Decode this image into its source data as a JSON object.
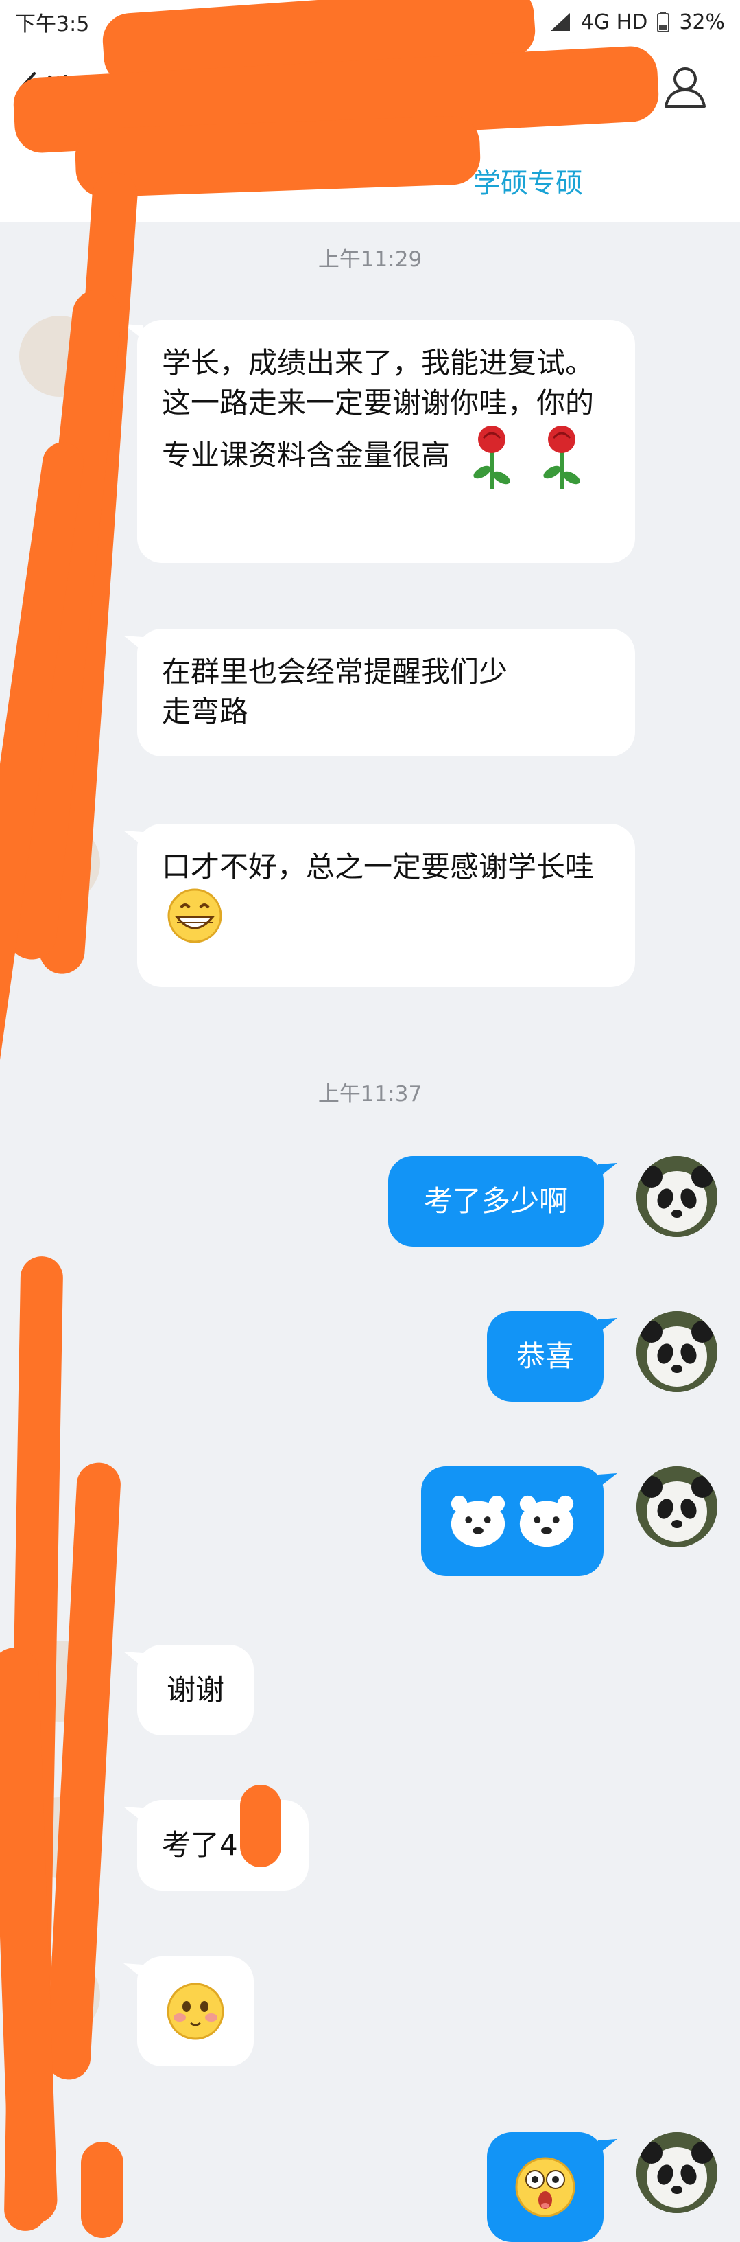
{
  "status_bar": {
    "time": "下午3:5",
    "network": "4G HD",
    "battery": "32%"
  },
  "header": {
    "back_label": "消",
    "group_tag": "学硕专硕"
  },
  "messages": {
    "time_1": "上午11:29",
    "in_1_text": "学长，成绩出来了，我能进复试。这一路走来一定要谢谢你哇，你的专业课资料含金量很高",
    "in_2_text": "在群里也会经常提醒我们少走弯路",
    "in_3_text": "口才不好，总之一定要感谢学长哇",
    "time_2": "上午11:37",
    "out_1_text": "考了多少啊",
    "out_2_text": "恭喜",
    "in_4_text": "谢谢",
    "in_5_text": "考了4"
  },
  "icons": {
    "back": "chevron-left-icon",
    "profile": "person-outline-icon",
    "rose": "rose-emoji-icon",
    "grin": "grinning-emoji-icon",
    "bear": "polar-bear-sticker-icon",
    "blush": "blushing-emoji-icon",
    "shock": "shocked-emoji-icon"
  },
  "colors": {
    "outgoing_bubble": "#1294f6",
    "incoming_bubble": "#ffffff",
    "background": "#eff1f4",
    "redaction": "#fe7327",
    "accent_link": "#1aa3d5"
  }
}
